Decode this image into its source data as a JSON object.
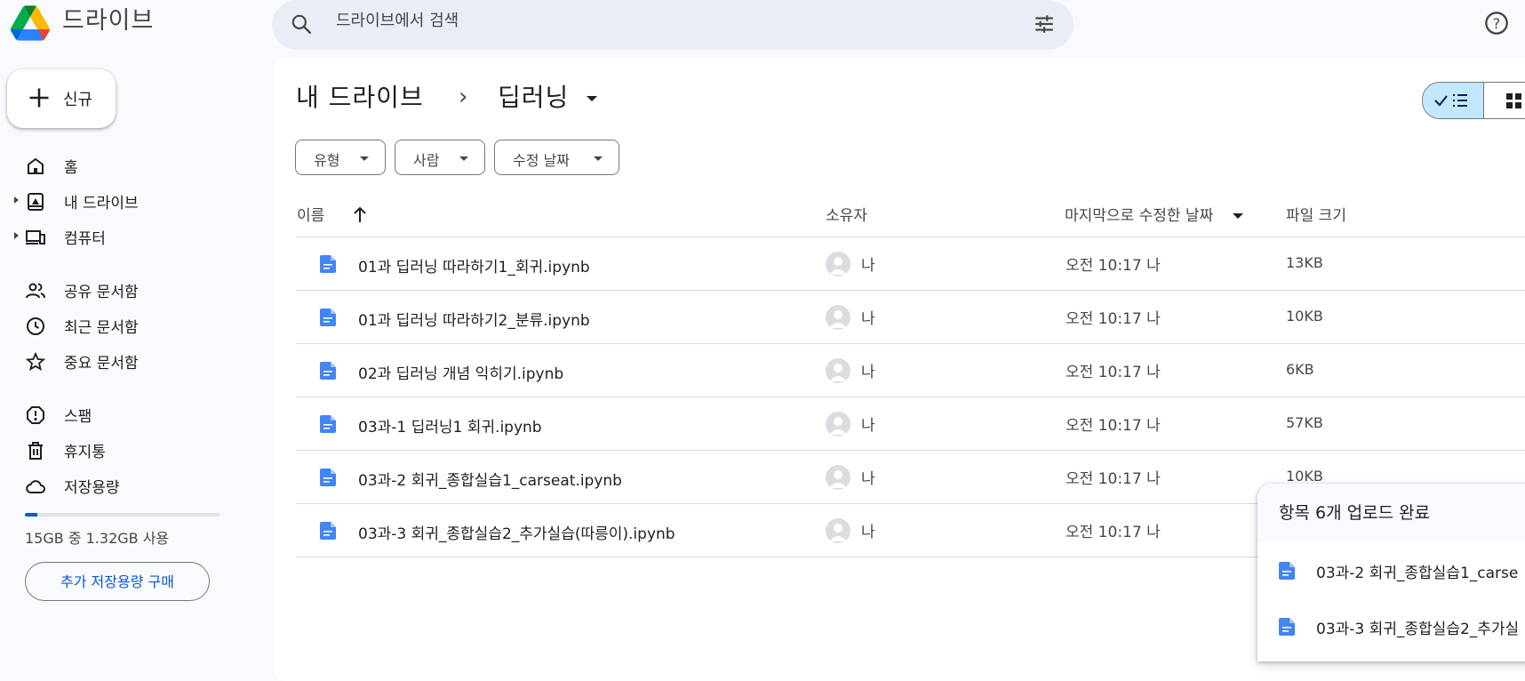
{
  "app": {
    "title": "드라이브"
  },
  "search": {
    "placeholder": "드라이브에서 검색"
  },
  "sidebar": {
    "new_label": "신규",
    "items": [
      {
        "label": "홈",
        "icon": "home-icon"
      },
      {
        "label": "내 드라이브",
        "icon": "my-drive-icon"
      },
      {
        "label": "컴퓨터",
        "icon": "computers-icon"
      },
      {
        "label": "공유 문서함",
        "icon": "people-icon"
      },
      {
        "label": "최근 문서함",
        "icon": "clock-icon"
      },
      {
        "label": "중요 문서함",
        "icon": "star-icon"
      },
      {
        "label": "스팸",
        "icon": "spam-icon"
      },
      {
        "label": "휴지통",
        "icon": "trash-icon"
      },
      {
        "label": "저장용량",
        "icon": "cloud-icon"
      }
    ],
    "storage": {
      "used_fraction": 0.066,
      "text": "15GB 중 1.32GB 사용",
      "buy_label": "추가 저장용량 구매"
    }
  },
  "breadcrumb": {
    "root": "내 드라이브",
    "separator": "›",
    "current": "딥러닝"
  },
  "filters": [
    {
      "label": "유형"
    },
    {
      "label": "사람"
    },
    {
      "label": "수정 날짜"
    }
  ],
  "table": {
    "headers": {
      "name": "이름",
      "owner": "소유자",
      "modified": "마지막으로 수정한 날짜",
      "size": "파일 크기"
    },
    "rows": [
      {
        "name": "01과 딥러닝 따라하기1_회귀.ipynb",
        "owner": "나",
        "modified": "오전 10:17 나",
        "size": "13KB"
      },
      {
        "name": "01과 딥러닝 따라하기2_분류.ipynb",
        "owner": "나",
        "modified": "오전 10:17 나",
        "size": "10KB"
      },
      {
        "name": "02과 딥러닝 개념 익히기.ipynb",
        "owner": "나",
        "modified": "오전 10:17 나",
        "size": "6KB"
      },
      {
        "name": "03과-1 딥러닝1 회귀.ipynb",
        "owner": "나",
        "modified": "오전 10:17 나",
        "size": "57KB"
      },
      {
        "name": "03과-2 회귀_종합실습1_carseat.ipynb",
        "owner": "나",
        "modified": "오전 10:17 나",
        "size": "10KB"
      },
      {
        "name": "03과-3 회귀_종합실습2_추가실습(따릉이).ipynb",
        "owner": "나",
        "modified": "오전 10:17 나",
        "size": ""
      }
    ]
  },
  "upload": {
    "title": "항목 6개 업로드 완료",
    "items": [
      {
        "name": "03과-2 회귀_종합실습1_carse"
      },
      {
        "name": "03과-3 회귀_종합실습2_추가실"
      }
    ]
  },
  "colors": {
    "accent": "#0b57d0",
    "selected": "#c2e7ff",
    "file_icon": "#4285f4",
    "background": "#f8fafd"
  }
}
